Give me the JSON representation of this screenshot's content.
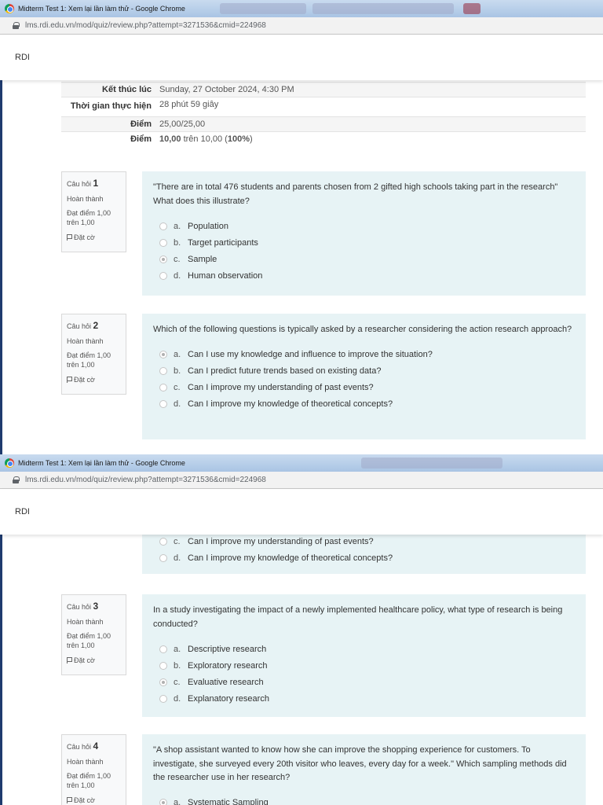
{
  "window1": {
    "title": "Midterm Test 1: Xem lại lần làm thử - Google Chrome",
    "url": "lms.rdi.edu.vn/mod/quiz/review.php?attempt=3271536&cmid=224968",
    "site_name": "RDI"
  },
  "window2": {
    "title": "Midterm Test 1: Xem lại lần làm thử - Google Chrome",
    "url": "lms.rdi.edu.vn/mod/quiz/review.php?attempt=3271536&cmid=224968",
    "site_name": "RDI"
  },
  "summary": [
    {
      "label": "Kết thúc lúc",
      "value": "Sunday, 27 October 2024, 4:30 PM"
    },
    {
      "label": "Thời gian thực hiện",
      "value": "28 phút 59 giây"
    },
    {
      "label": "Điểm",
      "value": "25,00/25,00"
    },
    {
      "label": "Điểm",
      "value_bold": "10,00",
      "value_mid": " trên 10,00 (",
      "value_pct": "100%",
      "value_end": ")"
    }
  ],
  "question_meta": {
    "number_prefix": "Câu hỏi",
    "status": "Hoàn thành",
    "score": "Đạt điểm 1,00 trên 1,00",
    "flag": "Đặt cờ"
  },
  "questions": [
    {
      "number": "1",
      "text": "\"There are in total 476 students and parents chosen from 2 gifted high schools taking part in the research\" What does this illustrate?",
      "answers": [
        {
          "letter": "a.",
          "text": "Population"
        },
        {
          "letter": "b.",
          "text": "Target participants"
        },
        {
          "letter": "c.",
          "text": "Sample"
        },
        {
          "letter": "d.",
          "text": "Human observation"
        }
      ],
      "selected": 2
    },
    {
      "number": "2",
      "text": "Which of the following questions is typically asked by a researcher considering the action research approach?",
      "answers": [
        {
          "letter": "a.",
          "text": "Can I use my knowledge and influence to improve the situation?"
        },
        {
          "letter": "b.",
          "text": "Can I predict future trends based on existing data?"
        },
        {
          "letter": "c.",
          "text": "Can I improve my understanding of past events?"
        },
        {
          "letter": "d.",
          "text": "Can I improve my knowledge of theoretical concepts?"
        }
      ],
      "selected": 0
    },
    {
      "number": "3",
      "text": "In a study investigating the impact of a newly implemented healthcare policy, what type of research is being conducted?",
      "answers": [
        {
          "letter": "a.",
          "text": "Descriptive research"
        },
        {
          "letter": "b.",
          "text": "Exploratory research"
        },
        {
          "letter": "c.",
          "text": "Evaluative research"
        },
        {
          "letter": "d.",
          "text": "Explanatory research"
        }
      ],
      "selected": 2
    },
    {
      "number": "4",
      "text": "\"A shop assistant wanted to know how she can improve the shopping experience for customers. To investigate, she surveyed every 20th visitor who leaves, every day for a week.\" Which sampling methods did the researcher use in her research?",
      "answers": [
        {
          "letter": "a.",
          "text": "Systematic Sampling"
        }
      ],
      "selected": 0
    }
  ]
}
